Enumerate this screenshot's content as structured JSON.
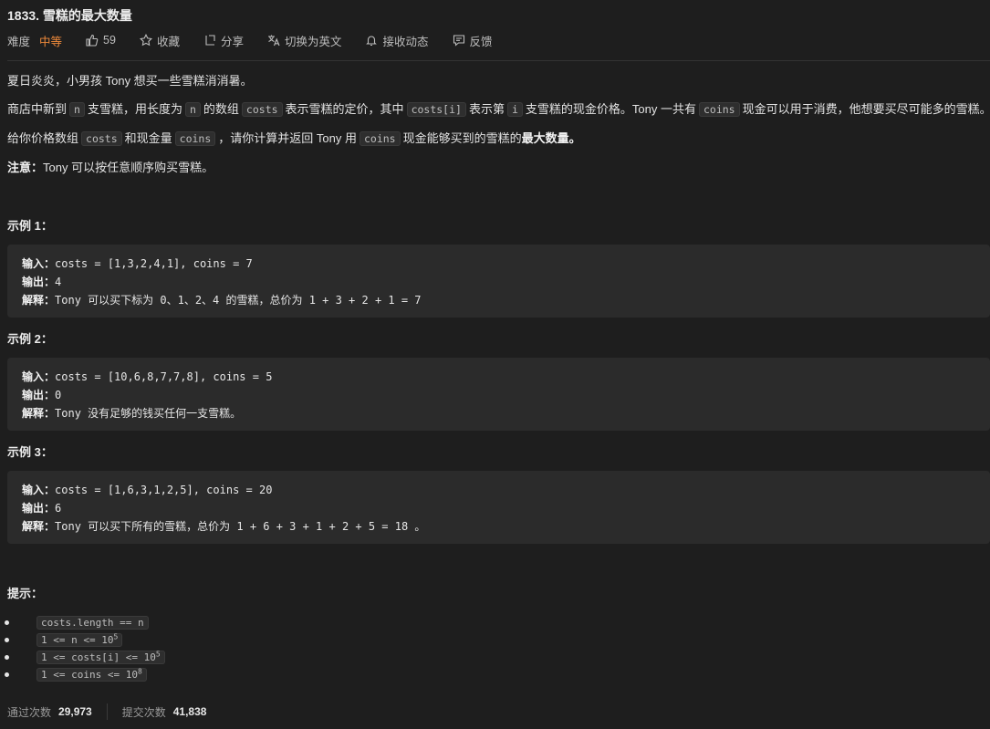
{
  "problem": {
    "title": "1833. 雪糕的最大数量"
  },
  "meta": {
    "difficulty_label": "难度",
    "difficulty": "中等",
    "likes": "59",
    "collect": "收藏",
    "share": "分享",
    "switch_lang": "切换为英文",
    "subscribe": "接收动态",
    "feedback": "反馈"
  },
  "desc": {
    "p1": "夏日炎炎，小男孩 Tony 想买一些雪糕消消暑。",
    "p2_a": "商店中新到",
    "p2_n": "n",
    "p2_b": "支雪糕，用长度为",
    "p2_n2": "n",
    "p2_c": "的数组",
    "p2_costs": "costs",
    "p2_d": "表示雪糕的定价，其中",
    "p2_costsi": "costs[i]",
    "p2_e": "表示第",
    "p2_i": "i",
    "p2_f": "支雪糕的现金价格。Tony 一共有",
    "p2_coins": "coins",
    "p2_g": "现金可以用于消费，他想要买尽可能多的雪糕。",
    "p3_a": "给你价格数组",
    "p3_costs": "costs",
    "p3_b": "和现金量",
    "p3_coins": "coins",
    "p3_c": "，请你计算并返回 Tony 用",
    "p3_coins2": "coins",
    "p3_d": "现金能够买到的雪糕的",
    "p3_bold": "最大数量",
    "p3_e": "。",
    "note_label": "注意：",
    "note_text": "Tony 可以按任意顺序购买雪糕。"
  },
  "examples": [
    {
      "heading": "示例 1：",
      "input_label": "输入：",
      "input": "costs = [1,3,2,4,1], coins = 7",
      "output_label": "输出：",
      "output": "4",
      "explain_label": "解释：",
      "explain": "Tony 可以买下标为 0、1、2、4 的雪糕，总价为 1 + 3 + 2 + 1 = 7"
    },
    {
      "heading": "示例 2：",
      "input_label": "输入：",
      "input": "costs = [10,6,8,7,7,8], coins = 5",
      "output_label": "输出：",
      "output": "0",
      "explain_label": "解释：",
      "explain": "Tony 没有足够的钱买任何一支雪糕。"
    },
    {
      "heading": "示例 3：",
      "input_label": "输入：",
      "input": "costs = [1,6,3,1,2,5], coins = 20",
      "output_label": "输出：",
      "output": "6",
      "explain_label": "解释：",
      "explain": "Tony 可以买下所有的雪糕，总价为 1 + 6 + 3 + 1 + 2 + 5 = 18 。"
    }
  ],
  "hints": {
    "heading": "提示：",
    "items": [
      {
        "text": "costs.length == n",
        "sup": ""
      },
      {
        "text": "1 <= n <= 10",
        "sup": "5"
      },
      {
        "text": "1 <= costs[i] <= 10",
        "sup": "5"
      },
      {
        "text": "1 <= coins <= 10",
        "sup": "8"
      }
    ]
  },
  "stats": {
    "accepted_label": "通过次数",
    "accepted": "29,973",
    "submitted_label": "提交次数",
    "submitted": "41,838"
  },
  "colors": {
    "background": "#1e1e1e",
    "difficulty_medium": "#ef8a3b",
    "code_block_bg": "#2b2b2b"
  },
  "icons": [
    "thumbs-up-icon",
    "star-icon",
    "share-icon",
    "translate-icon",
    "bell-icon",
    "feedback-icon"
  ]
}
